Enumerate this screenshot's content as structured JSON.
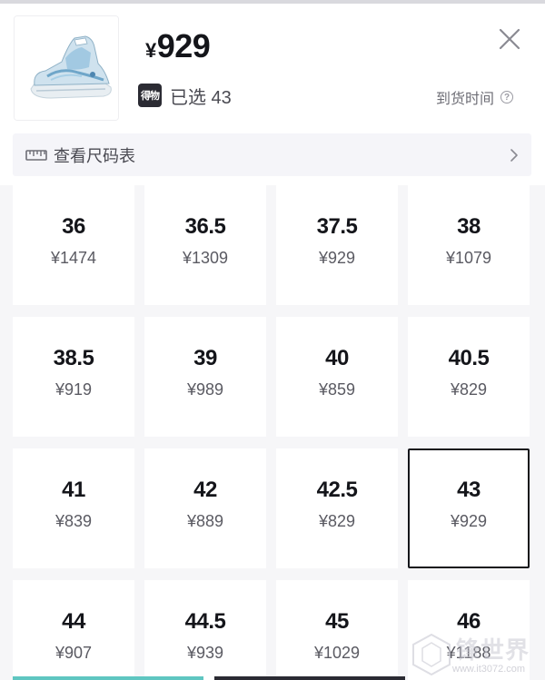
{
  "product": {
    "price_symbol": "¥",
    "price_value": "929",
    "badge_text": "得物",
    "selected_label": "已选 43",
    "arrival_label": "到货时间"
  },
  "size_chart": {
    "label": "查看尺码表"
  },
  "sizes": [
    {
      "size": "36",
      "price": "¥1474"
    },
    {
      "size": "36.5",
      "price": "¥1309"
    },
    {
      "size": "37.5",
      "price": "¥929"
    },
    {
      "size": "38",
      "price": "¥1079"
    },
    {
      "size": "38.5",
      "price": "¥919"
    },
    {
      "size": "39",
      "price": "¥989"
    },
    {
      "size": "40",
      "price": "¥859"
    },
    {
      "size": "40.5",
      "price": "¥829"
    },
    {
      "size": "41",
      "price": "¥839"
    },
    {
      "size": "42",
      "price": "¥889"
    },
    {
      "size": "42.5",
      "price": "¥829"
    },
    {
      "size": "43",
      "price": "¥929",
      "selected": true
    },
    {
      "size": "44",
      "price": "¥907"
    },
    {
      "size": "44.5",
      "price": "¥939"
    },
    {
      "size": "45",
      "price": "¥1029"
    },
    {
      "size": "46",
      "price": "¥1188"
    }
  ],
  "watermark": {
    "text": "锋世界",
    "url": "www.it3072.com"
  },
  "colors": {
    "accent_bar": "#5fc6c1",
    "dark_bar": "#2b2b33",
    "selected_border": "#14151a",
    "grid_bg": "#f6f6f8"
  }
}
